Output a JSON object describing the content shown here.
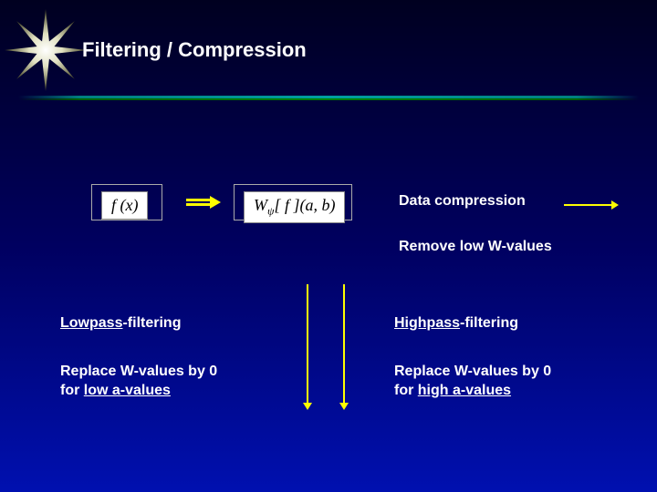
{
  "title": "Filtering / Compression",
  "formula1": "f (x)",
  "formula2_pre": "W",
  "formula2_sub": "ψ",
  "formula2_post": "[ f ](a, b)",
  "labels": {
    "data_compression": "Data compression",
    "remove_low": "Remove low W-values",
    "lowpass_u": "Lowpass",
    "lowpass_rest": "-filtering",
    "highpass_u": "Highpass",
    "highpass_rest": "-filtering",
    "lp_desc_1": "Replace W-values by 0",
    "lp_desc_2a": "for ",
    "lp_desc_2b": "low a-values",
    "hp_desc_1": "Replace W-values by 0",
    "hp_desc_2a": "for ",
    "hp_desc_2b": "high a-values"
  }
}
